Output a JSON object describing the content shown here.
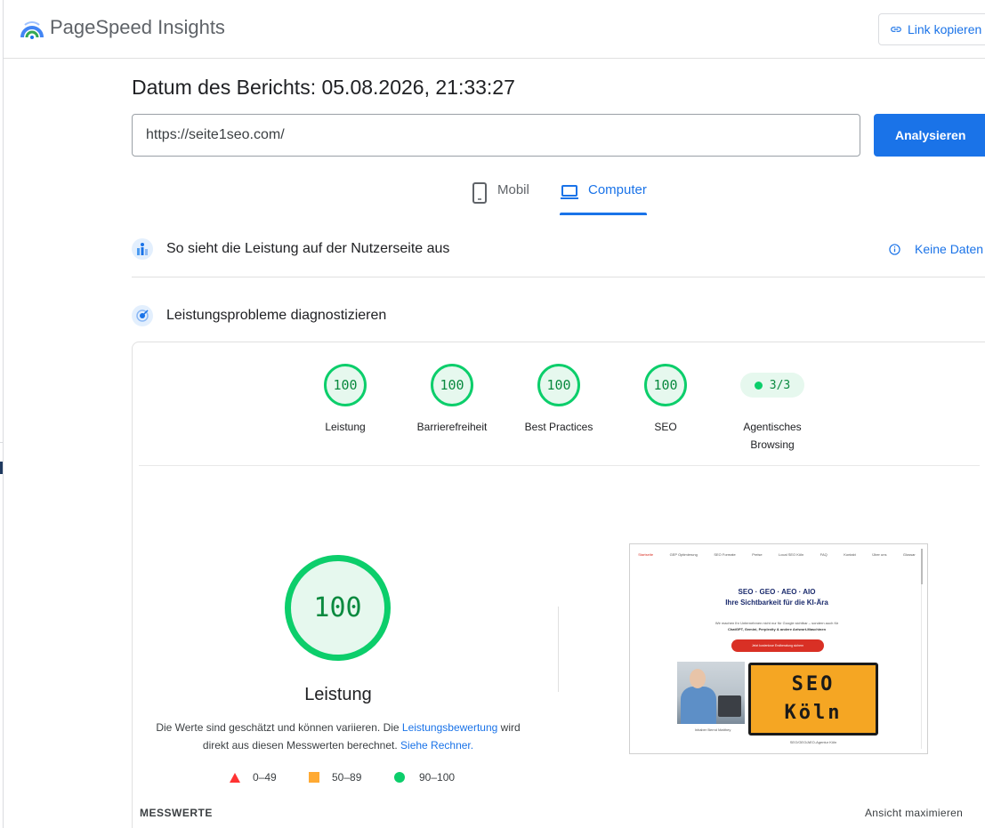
{
  "header": {
    "brand": "PageSpeed Insights",
    "copy_link_label": "Link kopieren"
  },
  "report": {
    "date_label": "Datum des Berichts: 05.08.2026, 21:33:27"
  },
  "search": {
    "url_value": "https://seite1seo.com/",
    "analyze_label": "Analysieren"
  },
  "tabs": {
    "mobile_label": "Mobil",
    "desktop_label": "Computer",
    "active": "Computer"
  },
  "sections": {
    "field_data_title": "So sieht die Leistung auf der Nutzerseite aus",
    "no_data_label": "Keine Daten",
    "diagnose_title": "Leistungsprobleme diagnostizieren"
  },
  "scores": [
    {
      "label": "Leistung",
      "value": "100"
    },
    {
      "label": "Barrierefreiheit",
      "value": "100"
    },
    {
      "label": "Best Practices",
      "value": "100"
    },
    {
      "label": "SEO",
      "value": "100"
    }
  ],
  "agentic": {
    "value": "3/3",
    "label_line1": "Agentisches",
    "label_line2": "Browsing"
  },
  "performance": {
    "score": "100",
    "label": "Leistung",
    "desc_part1": "Die Werte sind geschätzt und können variieren. Die ",
    "desc_link1": "Leistungsbewertung",
    "desc_part2": " wird direkt aus diesen Messwerten berechnet. ",
    "desc_link2": "Siehe Rechner."
  },
  "legend": {
    "poor": "0–49",
    "average": "50–89",
    "good": "90–100"
  },
  "metrics": {
    "title": "MESSWERTE",
    "maximize_label": "Ansicht maximieren"
  },
  "thumbnail": {
    "nav": [
      "Startseite",
      "GEP Optimierung",
      "SEO Formate",
      "Preise",
      "Local SEO Köln",
      "FAQ",
      "Kontakt",
      "Über uns",
      "Glossar"
    ],
    "headline_line1": "SEO · GEO · AEO · AIO",
    "headline_line2": "Ihre Sichtbarkeit für die KI-Ära",
    "subtext_line1": "Wir machen Ihr Unternehmen nicht nur für Google sichtbar – sondern auch für",
    "subtext_line2": "ChatGPT, Gemini, Perplexity & andere Antwort-Maschinen",
    "cta": "Jetzt kostenlose Erstberatung sichern",
    "sign_line1": "SEO",
    "sign_line2": "Köln",
    "caption_left": "Inhaber Bernd Matthey",
    "caption_right": "SEO/GEO/AEO-Agentur Köln"
  },
  "colors": {
    "accent": "#1a73e8",
    "good": "#0cce6b",
    "average": "#ffaa33",
    "poor": "#ff3333"
  }
}
